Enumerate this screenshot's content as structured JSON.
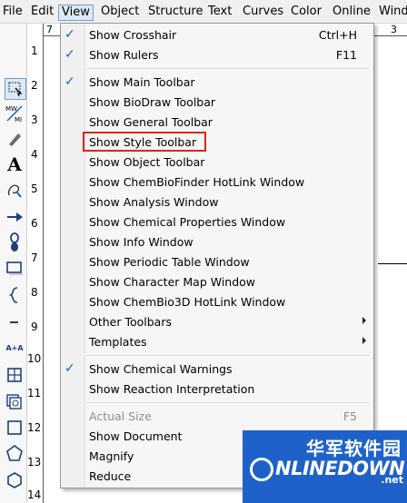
{
  "menubar": {
    "file": "File",
    "edit": "Edit",
    "view": "View",
    "object": "Object",
    "structure": "Structure",
    "text": "Text",
    "curves": "Curves",
    "color": "Color",
    "online": "Online",
    "window": "Wind"
  },
  "ruler": {
    "vertical": [
      "1",
      "2",
      "3",
      "4",
      "5",
      "6",
      "7",
      "8",
      "9",
      "10",
      "11",
      "12",
      "13",
      "14"
    ],
    "h_left": "7",
    "h_right": "3"
  },
  "toolbox": {
    "text_tool_glyph": "A",
    "mw_top": "MW",
    "mw_bottom": "MI",
    "reaction_glyph": "A+A"
  },
  "menu": {
    "items": [
      {
        "label": "Show Crosshair",
        "shortcut": "Ctrl+H",
        "checked": true
      },
      {
        "label": "Show Rulers",
        "shortcut": "F11",
        "checked": true
      },
      {
        "label": "Show Main Toolbar",
        "checked": true
      },
      {
        "label": "Show BioDraw Toolbar"
      },
      {
        "label": "Show General Toolbar"
      },
      {
        "label": "Show Style Toolbar",
        "highlighted": true
      },
      {
        "label": "Show Object Toolbar"
      },
      {
        "label": "Show ChemBioFinder HotLink Window"
      },
      {
        "label": "Show Analysis Window"
      },
      {
        "label": "Show Chemical Properties Window"
      },
      {
        "label": "Show Info Window"
      },
      {
        "label": "Show Periodic Table Window"
      },
      {
        "label": "Show Character Map Window"
      },
      {
        "label": "Show ChemBio3D HotLink Window"
      },
      {
        "label": "Other Toolbars",
        "submenu": true
      },
      {
        "label": "Templates",
        "submenu": true
      },
      {
        "label": "Show Chemical Warnings",
        "checked": true
      },
      {
        "label": "Show Reaction Interpretation"
      },
      {
        "label": "Actual Size",
        "shortcut": "F5",
        "disabled": true
      },
      {
        "label": "Show Document"
      },
      {
        "label": "Magnify"
      },
      {
        "label": "Reduce"
      }
    ],
    "check_glyph": "✓"
  },
  "watermark": {
    "cn": "华军软件园",
    "en": "NLINEDOWN",
    "suffix": ".net"
  },
  "colors": {
    "accent": "#1c63b6",
    "highlight": "#e0231c",
    "watermark_bg": "#1e62c9"
  }
}
